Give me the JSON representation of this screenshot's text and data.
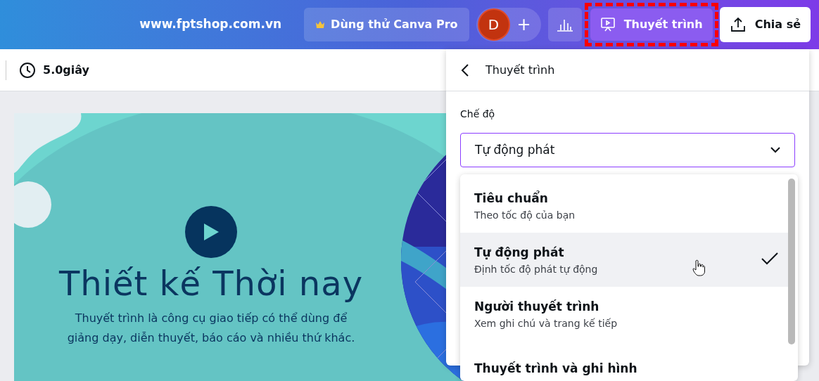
{
  "top_bar": {
    "website": "www.fptshop.com.vn",
    "pro_button": "Dùng thử Canva Pro",
    "avatar_initial": "D",
    "add_button": "+",
    "present_button": {
      "label": "Thuyết trình",
      "highlighted": true
    },
    "share_button": "Chia sẻ"
  },
  "toolbar": {
    "duration": "5.0giây"
  },
  "slide": {
    "title": "Thiết kế Thời nay",
    "body": "Thuyết trình là công cụ giao tiếp có thể dùng để giảng dạy, diễn thuyết, báo cáo và nhiều thứ khác."
  },
  "panel": {
    "title": "Thuyết trình",
    "mode_label": "Chế độ",
    "mode_value": "Tự động phát",
    "options": [
      {
        "title": "Tiêu chuẩn",
        "subtitle": "Theo tốc độ của bạn",
        "selected": false
      },
      {
        "title": "Tự động phát",
        "subtitle": "Định tốc độ phát tự động",
        "selected": true
      },
      {
        "title": "Người thuyết trình",
        "subtitle": "Xem ghi chú và trang kế tiếp",
        "selected": false
      },
      {
        "title": "Thuyết trình và ghi hình",
        "selected": false
      }
    ]
  }
}
